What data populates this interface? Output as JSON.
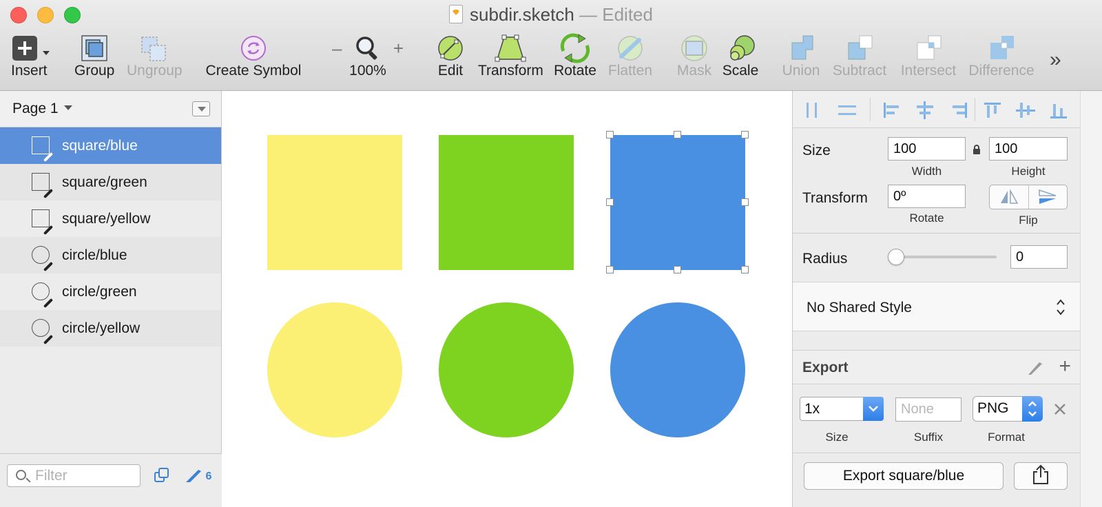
{
  "window": {
    "filename": "subdir.sketch",
    "status": "— Edited"
  },
  "toolbar": {
    "insert": "Insert",
    "group": "Group",
    "ungroup": "Ungroup",
    "create_symbol": "Create Symbol",
    "zoom_level": "100%",
    "zoom_minus": "–",
    "zoom_plus": "+",
    "edit": "Edit",
    "transform": "Transform",
    "rotate": "Rotate",
    "flatten": "Flatten",
    "mask": "Mask",
    "scale": "Scale",
    "union": "Union",
    "subtract": "Subtract",
    "intersect": "Intersect",
    "difference": "Difference",
    "overflow": "»"
  },
  "left_panel": {
    "page_name": "Page 1",
    "layers": [
      {
        "label": "square/blue",
        "shape": "square",
        "selected": true
      },
      {
        "label": "square/green",
        "shape": "square",
        "selected": false
      },
      {
        "label": "square/yellow",
        "shape": "square",
        "selected": false
      },
      {
        "label": "circle/blue",
        "shape": "circle",
        "selected": false
      },
      {
        "label": "circle/green",
        "shape": "circle",
        "selected": false
      },
      {
        "label": "circle/yellow",
        "shape": "circle",
        "selected": false
      }
    ],
    "filter_placeholder": "Filter",
    "slice_count": "6"
  },
  "canvas": {
    "colors": {
      "yellow": "#fbf074",
      "green": "#7ed321",
      "blue": "#4a90e2"
    }
  },
  "inspector": {
    "size_label": "Size",
    "width_value": "100",
    "width_label": "Width",
    "height_value": "100",
    "height_label": "Height",
    "transform_label": "Transform",
    "rotate_value": "0º",
    "rotate_label": "Rotate",
    "flip_label": "Flip",
    "radius_label": "Radius",
    "radius_value": "0",
    "radius_fraction": 0,
    "shared_style": "No Shared Style",
    "export": {
      "title": "Export",
      "size_value": "1x",
      "size_label": "Size",
      "suffix_placeholder": "None",
      "suffix_label": "Suffix",
      "format_value": "PNG",
      "format_label": "Format",
      "export_button": "Export square/blue"
    }
  }
}
